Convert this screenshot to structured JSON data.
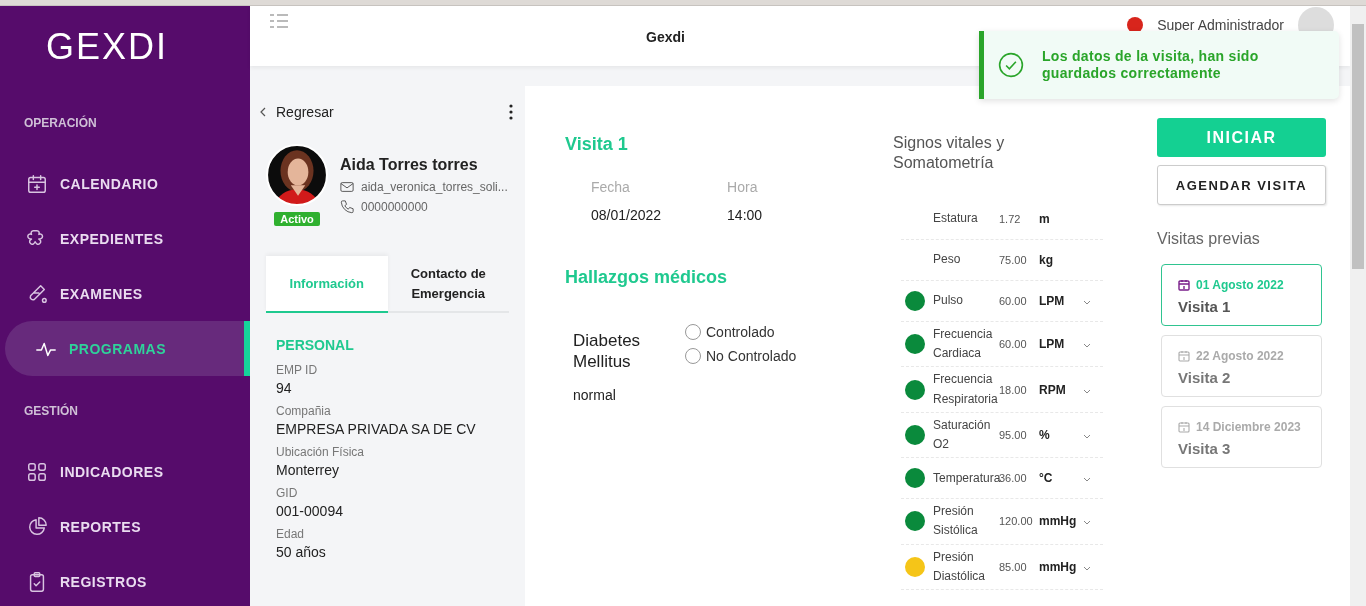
{
  "sidebar": {
    "logo": "GEXDI",
    "sections": [
      {
        "title": "OPERACIÓN",
        "items": [
          {
            "label": "CALENDARIO",
            "selected": false
          },
          {
            "label": "EXPEDIENTES",
            "selected": false
          },
          {
            "label": "EXAMENES",
            "selected": false
          },
          {
            "label": "PROGRAMAS",
            "selected": true
          }
        ]
      },
      {
        "title": "GESTIÓN",
        "items": [
          {
            "label": "INDICADORES",
            "selected": false
          },
          {
            "label": "REPORTES",
            "selected": false
          },
          {
            "label": "REGISTROS",
            "selected": false
          }
        ]
      }
    ]
  },
  "header": {
    "title": "Gexdi",
    "user": "Super Administrador"
  },
  "toast": {
    "message": "Los datos de la visita, han sido guardados correctamente"
  },
  "patient": {
    "back": "Regresar",
    "name": "Aida Torres torres",
    "email": "aida_veronica_torres_soli...",
    "phone": "0000000000",
    "status": "Activo",
    "tabs": [
      {
        "label": "Información",
        "selected": true
      },
      {
        "label": "Contacto de Emergencia",
        "selected": false
      }
    ],
    "section": "PERSONAL",
    "fields": [
      {
        "label": "EMP ID",
        "value": "94"
      },
      {
        "label": "Compañia",
        "value": "EMPRESA PRIVADA SA DE CV"
      },
      {
        "label": "Ubicación Física",
        "value": "Monterrey"
      },
      {
        "label": "GID",
        "value": "001-00094"
      },
      {
        "label": "Edad",
        "value": "50 años"
      }
    ]
  },
  "visit": {
    "title": "Visita 1",
    "date_label": "Fecha",
    "date": "08/01/2022",
    "time_label": "Hora",
    "time": "14:00",
    "findings_title": "Hallazgos médicos",
    "condition": "Diabetes Mellitus",
    "options": [
      {
        "label": "Controlado",
        "selected": false
      },
      {
        "label": "No Controlado",
        "selected": false
      }
    ],
    "note": "normal"
  },
  "vitals": {
    "title": "Signos vitales y Somatometría",
    "rows": [
      {
        "label": "Estatura",
        "value": "1.72",
        "unit": "m"
      },
      {
        "label": "Peso",
        "value": "75.00",
        "unit": "kg"
      },
      {
        "label": "Pulso",
        "value": "60.00",
        "unit": "LPM",
        "color": "#0a8a3c"
      },
      {
        "label": "Frecuencia Cardiaca",
        "value": "60.00",
        "unit": "LPM",
        "color": "#0a8a3c"
      },
      {
        "label": "Frecuencia Respiratoria",
        "value": "18.00",
        "unit": "RPM",
        "color": "#0a8a3c"
      },
      {
        "label": "Saturación O2",
        "value": "95.00",
        "unit": "%",
        "color": "#0a8a3c"
      },
      {
        "label": "Temperatura",
        "value": "36.00",
        "unit": "°C",
        "color": "#0a8a3c"
      },
      {
        "label": "Presión Sistólica",
        "value": "120.00",
        "unit": "mmHg",
        "color": "#0a8a3c"
      },
      {
        "label": "Presión Diastólica",
        "value": "85.00",
        "unit": "mmHg",
        "color": "#f5c518"
      }
    ]
  },
  "actions": {
    "start": "INICIAR",
    "schedule": "AGENDAR VISITA"
  },
  "previous": {
    "title": "Visitas previas",
    "visits": [
      {
        "date": "01 Agosto 2022",
        "name": "Visita 1",
        "selected": true
      },
      {
        "date": "22 Agosto 2022",
        "name": "Visita 2",
        "selected": false
      },
      {
        "date": "14 Diciembre 2023",
        "name": "Visita 3",
        "selected": false
      }
    ]
  }
}
